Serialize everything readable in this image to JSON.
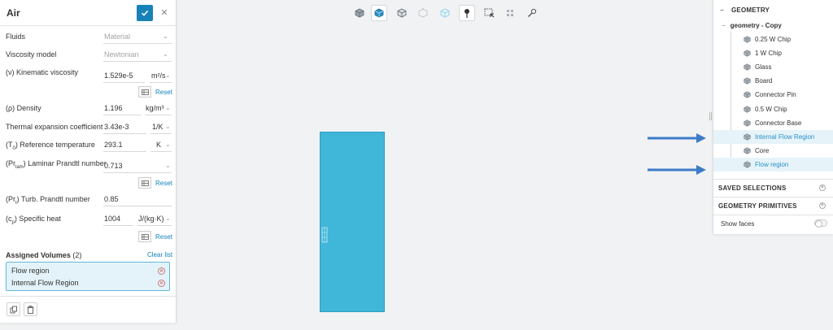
{
  "left_panel": {
    "title": "Air",
    "fluids": {
      "label": "Fluids",
      "value": "Material"
    },
    "viscosity_model": {
      "label": "Viscosity model",
      "value": "Newtonian"
    },
    "kinematic_viscosity": {
      "label": "(ν) Kinematic viscosity",
      "value": "1.529e-5",
      "unit": "m²/s"
    },
    "density": {
      "label": "(ρ) Density",
      "value": "1.196",
      "unit": "kg/m³"
    },
    "thermal_expansion": {
      "label": "Thermal expansion coefficient",
      "value": "3.43e-3",
      "unit": "1/K"
    },
    "reference_temperature": {
      "label_prefix": "(T",
      "label_sub": "0",
      "label_suffix": ") Reference temperature",
      "value": "293.1",
      "unit": "K"
    },
    "laminar_prandtl": {
      "label_prefix": "(Pr",
      "label_sub": "lam",
      "label_suffix": ") Laminar Prandtl number",
      "value": "0.713"
    },
    "turb_prandtl": {
      "label_prefix": "(Pr",
      "label_sub": "t",
      "label_suffix": ") Turb. Prandtl number",
      "value": "0.85"
    },
    "specific_heat": {
      "label_prefix": "(c",
      "label_sub": "p",
      "label_suffix": ") Specific heat",
      "value": "1004",
      "unit": "J/(kg·K)"
    },
    "reset_label": "Reset",
    "assigned_volumes": {
      "label": "Assigned Volumes",
      "count": "(2)",
      "clear_label": "Clear list",
      "items": [
        "Flow region",
        "Internal Flow Region"
      ]
    }
  },
  "right_panel": {
    "geometry_header": "GEOMETRY",
    "root_name": "geometry - Copy",
    "items": [
      "0.25 W Chip",
      "1 W Chip",
      "Glass",
      "Board",
      "Connector Pin",
      "0.5 W Chip",
      "Connector Base",
      "Internal Flow Region",
      "Core",
      "Flow region"
    ],
    "saved_selections": "SAVED SELECTIONS",
    "geometry_primitives": "GEOMETRY PRIMITIVES",
    "show_faces": "Show faces"
  },
  "colors": {
    "accent": "#1782b8",
    "highlight": "#e6f4fa",
    "object": "#40b6d8",
    "arrow": "#3d7bc8"
  }
}
